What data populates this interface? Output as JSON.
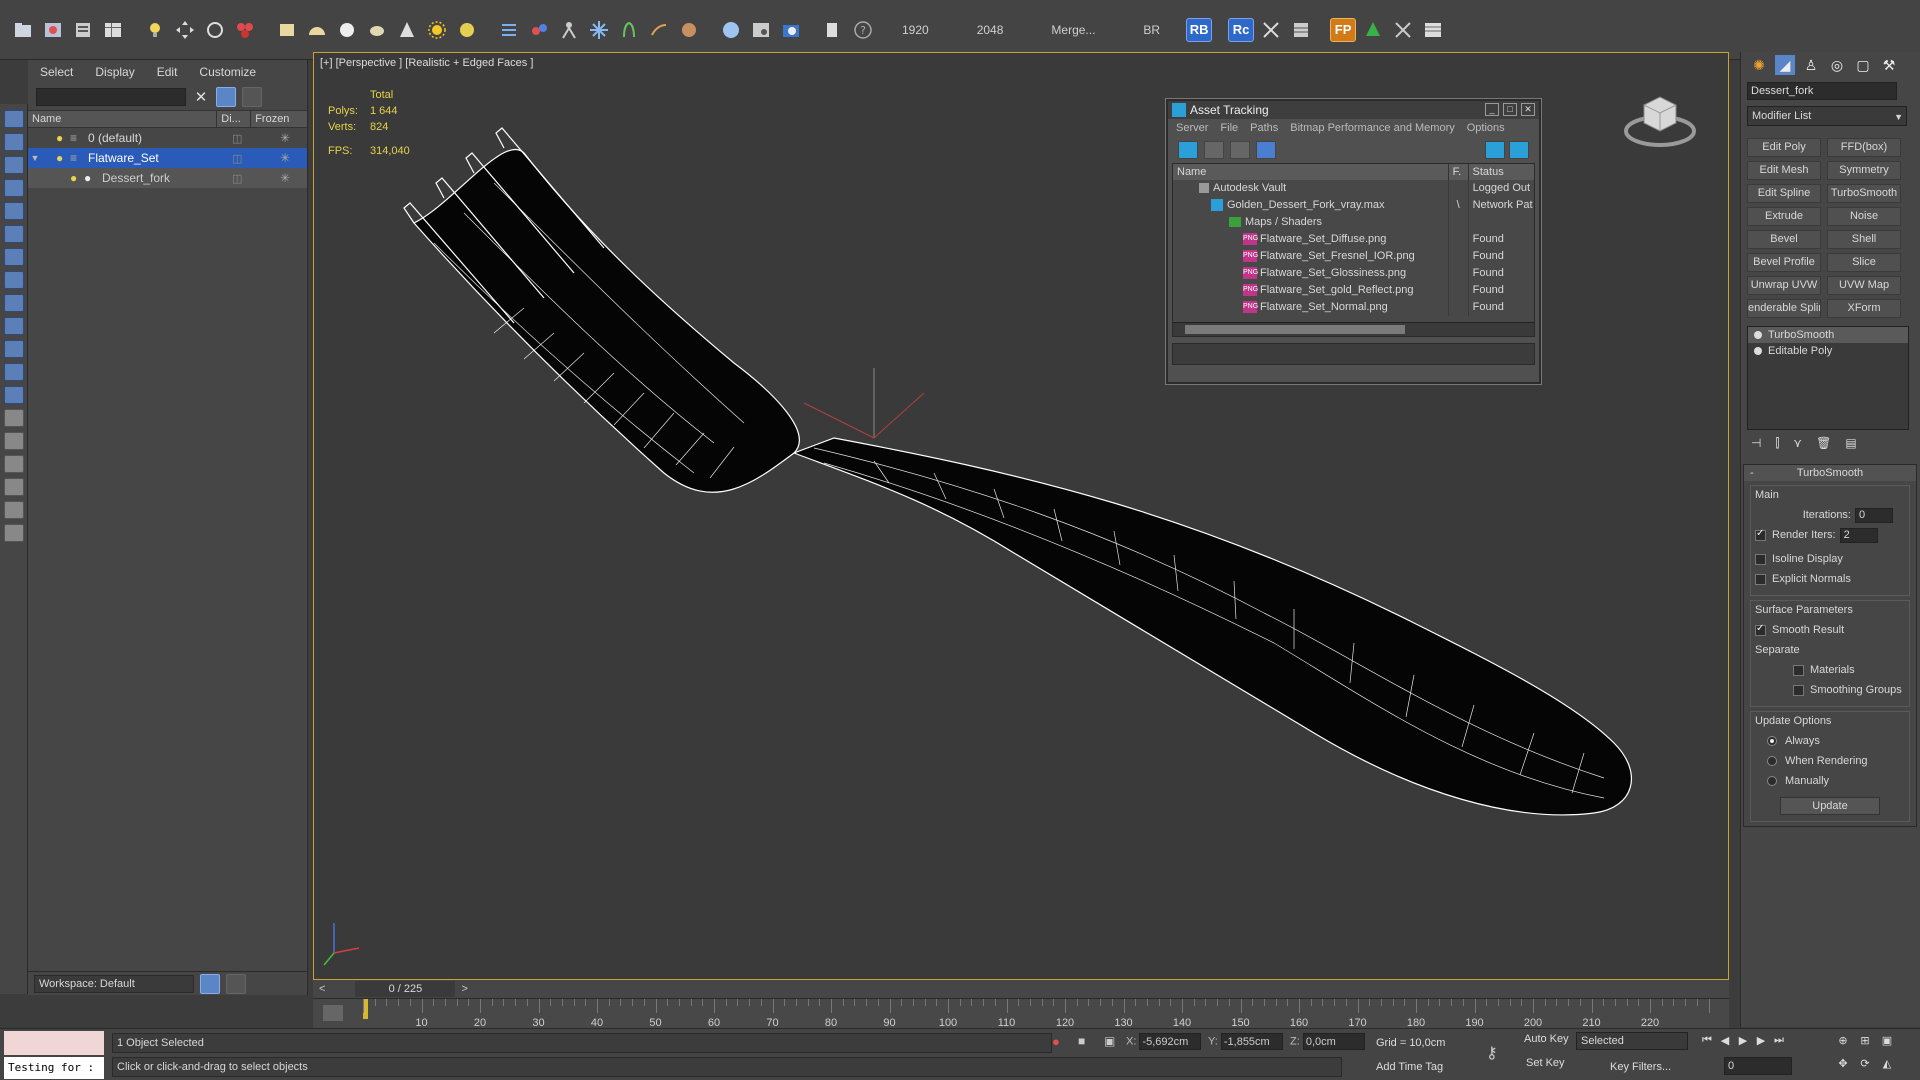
{
  "toolbar": {
    "render_width": "1920",
    "render_height": "2048",
    "merge_label": "Merge...",
    "br_label": "BR",
    "rb_badge": "RB",
    "rc_badge": "Rc",
    "fp_badge": "FP"
  },
  "explorer": {
    "menu": [
      "Select",
      "Display",
      "Edit",
      "Customize"
    ],
    "columns": [
      "Name",
      "Di...",
      "Frozen"
    ],
    "rows": [
      {
        "name": "0 (default)"
      },
      {
        "name": "Flatware_Set"
      },
      {
        "name": "Dessert_fork"
      }
    ],
    "workspace": "Workspace: Default"
  },
  "viewport": {
    "label": "[+] [Perspective ] [Realistic + Edged Faces ]",
    "stats_header": "Total",
    "polys_label": "Polys:",
    "polys_value": "1 644",
    "verts_label": "Verts:",
    "verts_value": "824",
    "fps_label": "FPS:",
    "fps_value": "314,040"
  },
  "timeline": {
    "frame_display": "0 / 225",
    "ticks": [
      "10",
      "20",
      "30",
      "40",
      "50",
      "60",
      "70",
      "80",
      "90",
      "100",
      "110",
      "120",
      "130",
      "140",
      "150",
      "160",
      "170",
      "180",
      "190",
      "200",
      "210",
      "220"
    ]
  },
  "asset_tracking": {
    "title": "Asset Tracking",
    "menu": [
      "Server",
      "File",
      "Paths",
      "Bitmap Performance and Memory",
      "Options"
    ],
    "columns": [
      "Name",
      "F.",
      "Status"
    ],
    "rows": [
      {
        "name": "Autodesk Vault",
        "f": "",
        "status": "Logged Out"
      },
      {
        "name": "Golden_Dessert_Fork_vray.max",
        "f": "\\",
        "status": "Network Pat"
      },
      {
        "name": "Maps / Shaders",
        "f": "",
        "status": ""
      },
      {
        "name": "Flatware_Set_Diffuse.png",
        "f": "",
        "status": "Found"
      },
      {
        "name": "Flatware_Set_Fresnel_IOR.png",
        "f": "",
        "status": "Found"
      },
      {
        "name": "Flatware_Set_Glossiness.png",
        "f": "",
        "status": "Found"
      },
      {
        "name": "Flatware_Set_gold_Reflect.png",
        "f": "",
        "status": "Found"
      },
      {
        "name": "Flatware_Set_Normal.png",
        "f": "",
        "status": "Found"
      }
    ],
    "png_tag": "PNG"
  },
  "command_panel": {
    "object_name": "Dessert_fork",
    "modifier_list": "Modifier List",
    "modifier_buttons": [
      "Edit Poly",
      "FFD(box)",
      "Edit Mesh",
      "Symmetry",
      "Edit Spline",
      "TurboSmooth",
      "Extrude",
      "Noise",
      "Bevel",
      "Shell",
      "Bevel Profile",
      "Slice",
      "Unwrap UVW",
      "UVW Map",
      "enderable Splir",
      "XForm"
    ],
    "stack": [
      "TurboSmooth",
      "Editable Poly"
    ],
    "rollout_title": "TurboSmooth",
    "main_label": "Main",
    "iterations_label": "Iterations:",
    "iterations_value": "0",
    "render_iters_label": "Render Iters:",
    "render_iters_value": "2",
    "isoline_label": "Isoline Display",
    "explicit_normals_label": "Explicit Normals",
    "surface_label": "Surface Parameters",
    "smooth_result_label": "Smooth Result",
    "separate_label": "Separate",
    "materials_label": "Materials",
    "smoothing_groups_label": "Smoothing Groups",
    "update_options_label": "Update Options",
    "always_label": "Always",
    "when_rendering_label": "When Rendering",
    "manually_label": "Manually",
    "update_button": "Update"
  },
  "status": {
    "script_text": "Testing for :",
    "selection": "1 Object Selected",
    "prompt": "Click or click-and-drag to select objects",
    "x_label": "X:",
    "x_value": "-5,692cm",
    "y_label": "Y:",
    "y_value": "-1,855cm",
    "z_label": "Z:",
    "z_value": "0,0cm",
    "grid": "Grid = 10,0cm",
    "add_time_tag": "Add Time Tag",
    "auto_key": "Auto Key",
    "set_key": "Set Key",
    "selected": "Selected",
    "key_filters": "Key Filters...",
    "frame_value": "0"
  },
  "colors": {
    "accent_blue": "#2a5bb8",
    "viewport_border": "#c8a235",
    "stat_yellow": "#e6d24a"
  }
}
